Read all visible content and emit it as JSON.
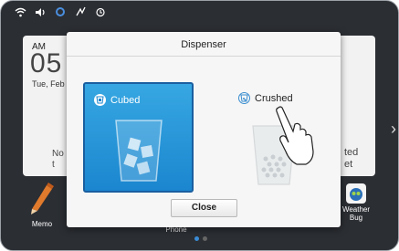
{
  "status_icons": [
    "wifi-icon",
    "sound-icon",
    "settings-icon",
    "signal-icon",
    "alarm-icon"
  ],
  "clock": {
    "ampm": "AM",
    "time": "05",
    "date": "Tue, Feb"
  },
  "widget_notes": {
    "left_line1": "No",
    "left_line2": "t",
    "right_line1": "ted",
    "right_line2": "et"
  },
  "dialog": {
    "title": "Dispenser",
    "options": [
      {
        "label": "Cubed",
        "selected": true
      },
      {
        "label": "Crushed",
        "selected": false
      }
    ],
    "close_label": "Close"
  },
  "dock": {
    "memo": "Memo",
    "phone": "Phone",
    "weather": "Weather Bug"
  },
  "colors": {
    "accent": "#1b86cf",
    "dialog_bg": "#f6f6f6",
    "screen_bg": "#2b2e33"
  }
}
